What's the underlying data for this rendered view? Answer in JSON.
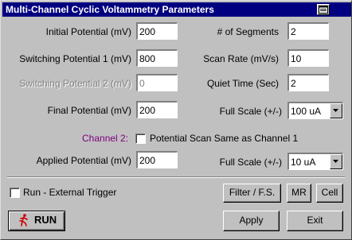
{
  "window": {
    "title": "Multi-Channel Cyclic Voltammetry Parameters"
  },
  "left": {
    "initial_potential": {
      "label": "Initial Potential (mV)",
      "value": "200"
    },
    "switching_potential_1": {
      "label": "Switching Potential 1 (mV)",
      "value": "800"
    },
    "switching_potential_2": {
      "label": "Switching Potential 2 (mV)",
      "value": "0"
    },
    "final_potential": {
      "label": "Final Potential (mV)",
      "value": "200"
    }
  },
  "right": {
    "segments": {
      "label": "# of Segments",
      "value": "2"
    },
    "scan_rate": {
      "label": "Scan Rate (mV/s)",
      "value": "10"
    },
    "quiet_time": {
      "label": "Quiet Time (Sec)",
      "value": "2"
    },
    "full_scale_1": {
      "label": "Full Scale (+/-)",
      "value": "100 uA"
    }
  },
  "channel2": {
    "label": "Channel 2:",
    "same_scan_label": "Potential Scan Same as Channel 1",
    "applied_potential": {
      "label": "Applied Potential (mV)",
      "value": "200"
    },
    "full_scale_2": {
      "label": "Full Scale (+/-)",
      "value": "10 uA"
    }
  },
  "trigger": {
    "label": "Run - External Trigger"
  },
  "buttons": {
    "filter": "Filter / F.S.",
    "mr": "MR",
    "cell": "Cell",
    "run": "RUN",
    "apply": "Apply",
    "exit": "Exit"
  },
  "icons": {
    "run": "running-man-icon",
    "title_button": "window-icon"
  },
  "colors": {
    "titlebar": "#000080",
    "channel_label": "#800080",
    "run_icon": "#cc0000"
  }
}
